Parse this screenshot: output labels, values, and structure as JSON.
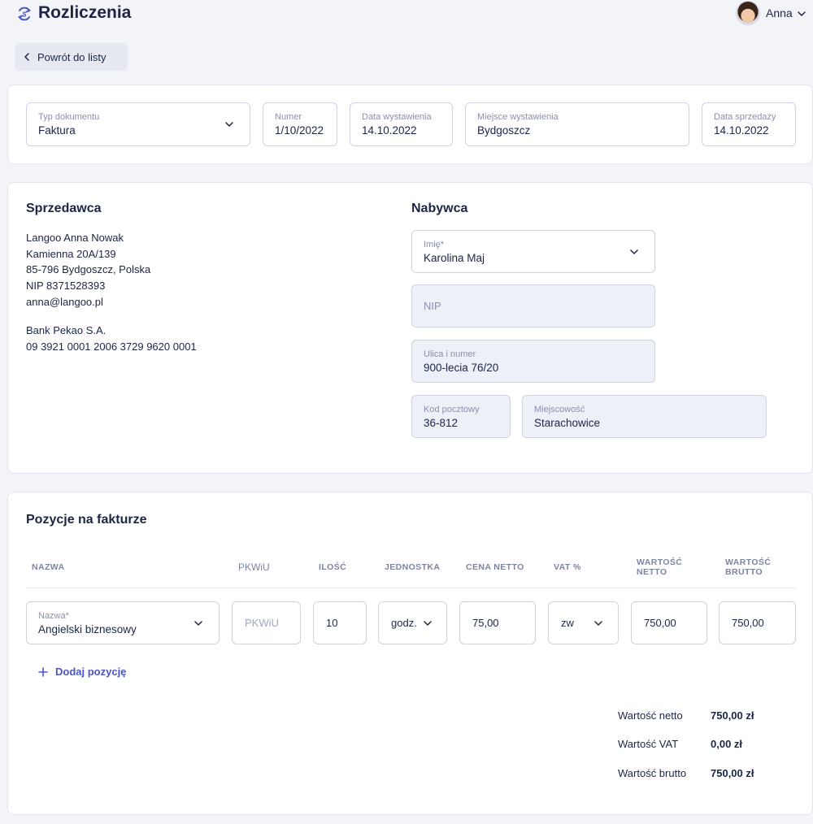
{
  "app": {
    "title": "Rozliczenia",
    "user_name": "Anna"
  },
  "back_button": {
    "label": "Powrót do listy"
  },
  "document": {
    "type": {
      "label": "Typ dokumentu",
      "value": "Faktura"
    },
    "number": {
      "label": "Numer",
      "value": "1/10/2022"
    },
    "issue_date": {
      "label": "Data wystawienia",
      "value": "14.10.2022"
    },
    "issue_place": {
      "label": "Miejsce wystawienia",
      "value": "Bydgoszcz"
    },
    "sale_date": {
      "label": "Data sprzedaży",
      "value": "14.10.2022"
    }
  },
  "seller": {
    "title": "Sprzedawca",
    "lines": [
      "Langoo Anna Nowak",
      "Kamienna 20A/139",
      "85-796 Bydgoszcz, Polska",
      "NIP 8371528393",
      "anna@langoo.pl"
    ],
    "bank": [
      "Bank Pekao S.A.",
      "09 3921 0001 2006 3729 9620 0001"
    ]
  },
  "buyer": {
    "title": "Nabywca",
    "name": {
      "label": "Imię*",
      "value": "Karolina Maj"
    },
    "nip": {
      "placeholder": "NIP"
    },
    "street": {
      "label": "Ulica i numer",
      "value": "900-lecia 76/20"
    },
    "postal": {
      "label": "Kod pocztowy",
      "value": "36-812"
    },
    "city": {
      "label": "Miejscowość",
      "value": "Starachowice"
    }
  },
  "items": {
    "title": "Pozycje na fakturze",
    "columns": {
      "name": "NAZWA",
      "pkwiu": "PKWiU",
      "qty": "ILOŚĆ",
      "unit": "JEDNOSTKA",
      "price": "CENA NETTO",
      "vat": "VAT %",
      "net_1": "WARTOŚĆ",
      "net_2": "NETTO",
      "gross_1": "WARTOŚĆ",
      "gross_2": "BRUTTO"
    },
    "rows": [
      {
        "name_label": "Nazwa*",
        "name": "Angielski biznesowy",
        "pkwiu_placeholder": "PKWiU",
        "qty": "10",
        "unit": "godz.",
        "price": "75,00",
        "vat": "zw",
        "net": "750,00",
        "gross": "750,00"
      }
    ],
    "add_label": "Dodaj pozycję"
  },
  "summary": {
    "net_label": "Wartość netto",
    "net_value": "750,00 zł",
    "vat_label": "Wartość VAT",
    "vat_value": "0,00 zł",
    "gross_label": "Wartość brutto",
    "gross_value": "750,00 zł"
  },
  "colors": {
    "accent": "#4a55c9",
    "text": "#1c2545",
    "muted": "#8a90a8",
    "background": "#f3f4f8",
    "filled_field": "#eef0f8"
  }
}
